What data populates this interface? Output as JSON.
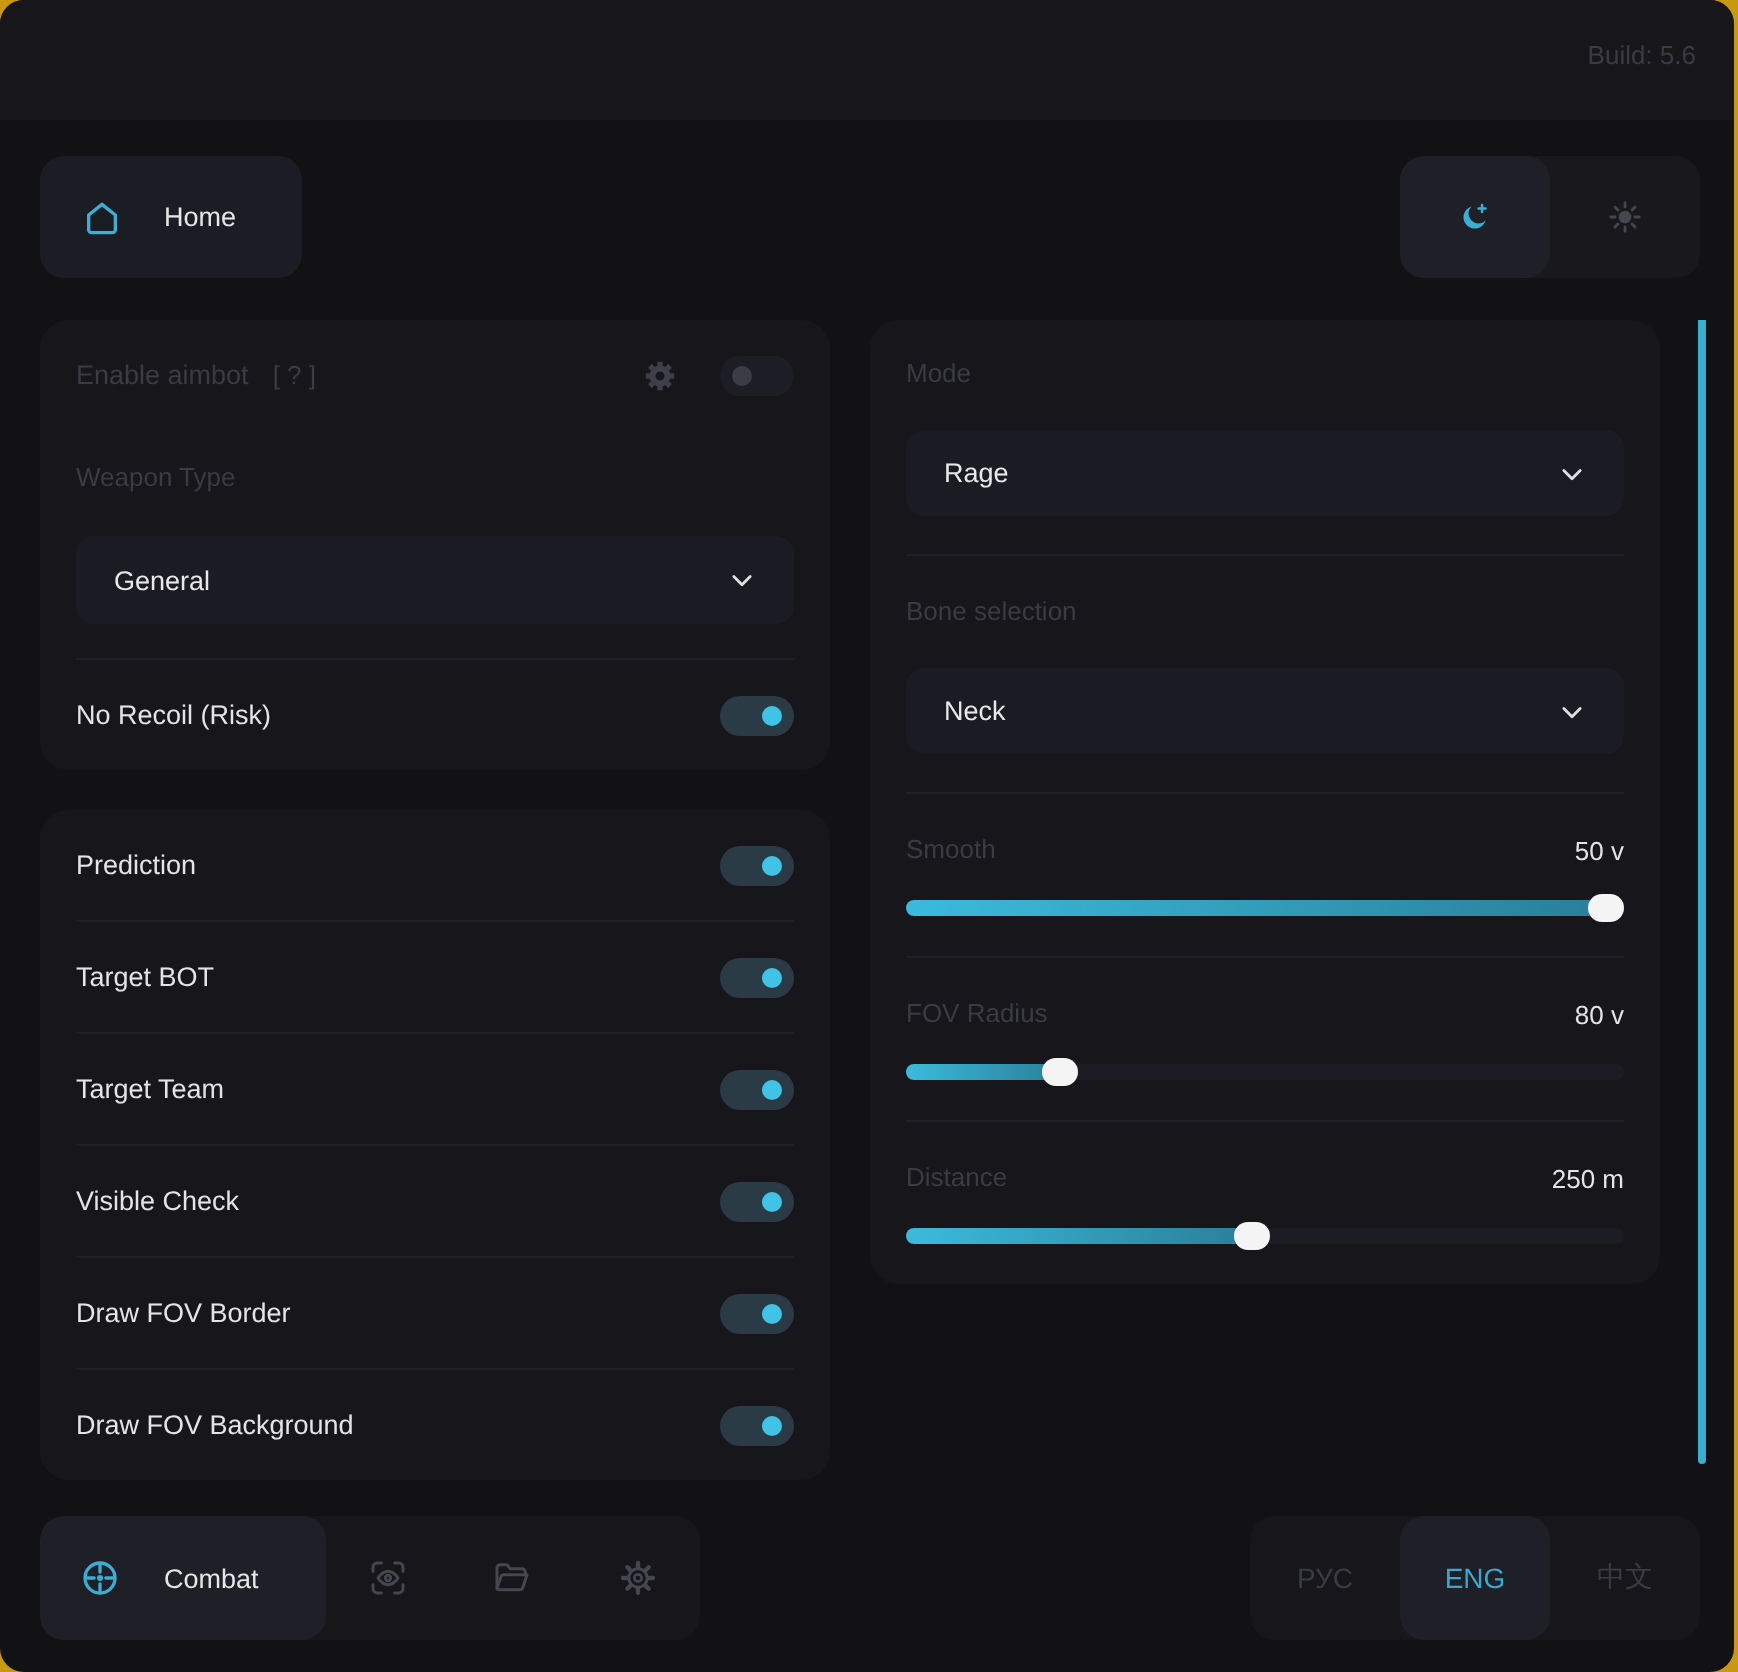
{
  "header": {
    "build": "Build: 5.6"
  },
  "home_button": {
    "label": "Home"
  },
  "theme_switch": [
    {
      "kind": "moon",
      "selected": true
    },
    {
      "kind": "sun",
      "selected": false
    }
  ],
  "left_panel": {
    "master": {
      "label": "Enable aimbot",
      "help": "[ ? ]",
      "on": false,
      "disabled": true
    },
    "weapon_type": {
      "label": "Weapon Type",
      "value": "General"
    },
    "no_recoil": {
      "label": "No Recoil (Risk)",
      "on": true
    }
  },
  "toggles": [
    {
      "label": "Prediction",
      "on": true
    },
    {
      "label": "Target BOT",
      "on": true
    },
    {
      "label": "Target Team",
      "on": true
    },
    {
      "label": "Visible Check",
      "on": true
    },
    {
      "label": "Draw FOV Border",
      "on": true
    },
    {
      "label": "Draw FOV Background",
      "on": true
    }
  ],
  "right_panel": {
    "selects": [
      {
        "label": "Mode",
        "value": "Rage"
      },
      {
        "label": "Bone selection",
        "value": "Neck"
      }
    ],
    "sliders": [
      {
        "label": "Smooth",
        "reading": "50 v",
        "level": 1
      },
      {
        "label": "FOV Radius",
        "reading": "80 v",
        "level": 0.2
      },
      {
        "label": "Distance",
        "reading": "250 m",
        "level": 0.48
      }
    ]
  },
  "nav": [
    {
      "kind": "target",
      "label": "Combat",
      "selected": true
    },
    {
      "kind": "eye",
      "selected": false
    },
    {
      "kind": "folder",
      "selected": false
    },
    {
      "kind": "gear",
      "selected": false
    }
  ],
  "languages": [
    {
      "label": "РУС",
      "selected": false
    },
    {
      "label": "ENG",
      "selected": true
    },
    {
      "label": "中文",
      "selected": false
    }
  ]
}
